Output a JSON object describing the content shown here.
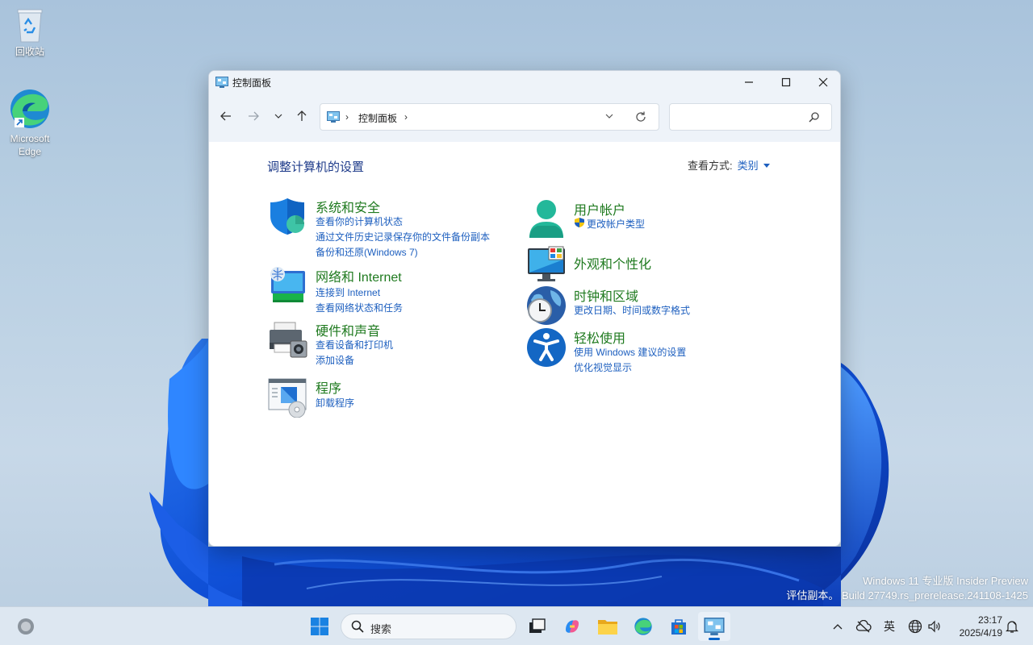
{
  "desktop": {
    "icons": [
      {
        "label": "回收站",
        "icon": "recycle-bin-icon"
      },
      {
        "label": "Microsoft Edge",
        "icon": "edge-icon"
      }
    ],
    "watermark_line1": "Windows 11 专业版 Insider Preview",
    "watermark_line2": "评估副本。 Build 27749.rs_prerelease.241108-1425"
  },
  "window": {
    "title": "控制面板",
    "address": {
      "crumb": "控制面板",
      "separator": "›"
    },
    "search_placeholder": "",
    "heading": "调整计算机的设置",
    "view_by": {
      "label": "查看方式:",
      "value": "类别"
    },
    "categories_left": [
      {
        "title": "系统和安全",
        "icon": "shield-icon",
        "links": [
          "查看你的计算机状态",
          "通过文件历史记录保存你的文件备份副本",
          "备份和还原(Windows 7)"
        ]
      },
      {
        "title": "网络和 Internet",
        "icon": "network-icon",
        "links": [
          "连接到 Internet",
          "查看网络状态和任务"
        ]
      },
      {
        "title": "硬件和声音",
        "icon": "printer-icon",
        "links": [
          "查看设备和打印机",
          "添加设备"
        ]
      },
      {
        "title": "程序",
        "icon": "programs-icon",
        "links": [
          "卸载程序"
        ]
      }
    ],
    "categories_right": [
      {
        "title": "用户帐户",
        "icon": "user-icon",
        "links": [
          "更改帐户类型"
        ]
      },
      {
        "title": "外观和个性化",
        "icon": "monitor-icon",
        "links": []
      },
      {
        "title": "时钟和区域",
        "icon": "clock-globe-icon",
        "links": [
          "更改日期、时间或数字格式"
        ]
      },
      {
        "title": "轻松使用",
        "icon": "accessibility-icon",
        "links": [
          "使用 Windows 建议的设置",
          "优化视觉显示"
        ]
      }
    ]
  },
  "taskbar": {
    "search_label": "搜索",
    "ime": "英",
    "time": "23:17",
    "date": "2025/4/19"
  },
  "colors": {
    "accent": "#0a64c8",
    "category_title": "#1f7a1f",
    "link": "#1d5fbf",
    "heading": "#1e3b8a"
  }
}
